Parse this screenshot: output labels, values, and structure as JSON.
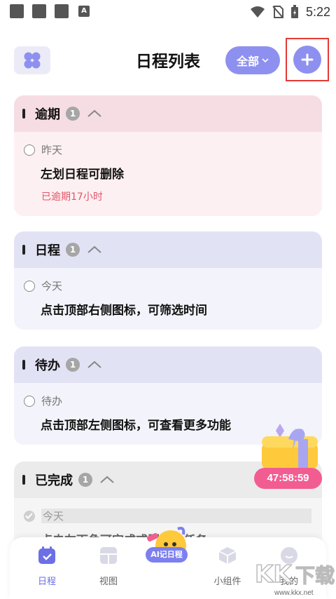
{
  "status_bar": {
    "time": "5:22"
  },
  "header": {
    "title": "日程列表",
    "filter_label": "全部"
  },
  "sections": [
    {
      "title": "逾期",
      "count": "1",
      "items": [
        {
          "date": "昨天",
          "text": "左划日程可删除",
          "overdue": "已逾期17小时"
        }
      ]
    },
    {
      "title": "日程",
      "count": "1",
      "items": [
        {
          "date": "今天",
          "text": "点击顶部右侧图标，可筛选时间"
        }
      ]
    },
    {
      "title": "待办",
      "count": "1",
      "items": [
        {
          "date": "待办",
          "text": "点击顶部左侧图标，可查看更多功能"
        }
      ]
    },
    {
      "title": "已完成",
      "count": "1",
      "items": [
        {
          "date": "今天",
          "text": "点击左下角可完成或删除此任务"
        }
      ]
    }
  ],
  "promo": {
    "timer": "47:58:59"
  },
  "bottom_nav": {
    "schedule": "日程",
    "view": "视图",
    "ai": "AI记日程",
    "widgets": "小组件",
    "mine": "我的"
  },
  "watermark": {
    "brand": "KK下载",
    "url": "www.kkx.net"
  },
  "colors": {
    "accent": "#8e90f0",
    "overdue_bg": "#fae8ec",
    "overdue_head": "#f5dde3",
    "schedule_bg": "#f1f1fb",
    "schedule_head": "#e2e2f5",
    "done_bg": "#f4f4f4",
    "timer": "#f25d91",
    "highlight": "#e53935"
  }
}
